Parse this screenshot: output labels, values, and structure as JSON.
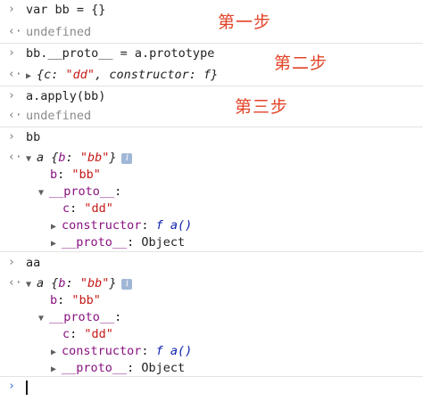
{
  "entries": [
    {
      "input": "var bb = {}",
      "output": "undefined",
      "annotation": "第一步"
    },
    {
      "input": "bb.__proto__ = a.prototype",
      "annotation": "第二步"
    },
    {
      "input": "a.apply(bb)",
      "output": "undefined",
      "annotation": "第三步"
    },
    {
      "input": "bb"
    },
    {
      "input": "aa"
    }
  ],
  "entry2_output": {
    "open": "{",
    "c_key": "c",
    "c_val": "\"dd\"",
    "comma": ", ",
    "ctor_key": "constructor",
    "ctor_val": "f",
    "close": "}"
  },
  "obj": {
    "head_name": "a",
    "head_open": "{",
    "head_key": "b",
    "head_val": "\"bb\"",
    "head_close": "}",
    "info": "i",
    "b_key": "b",
    "b_val": "\"bb\"",
    "proto_key": "__proto__",
    "c_key": "c",
    "c_val": "\"dd\"",
    "ctor_key": "constructor",
    "ctor_val": "f a()",
    "proto2_key": "__proto__",
    "proto2_val": "Object"
  },
  "symbols": {
    "prompt": "›",
    "result": "‹·",
    "expand": "▶",
    "collapse": "▼",
    "colon": ":"
  },
  "colors": {
    "annotation": "#e24428",
    "string": "#c41a16",
    "key": "#881280",
    "prompt_active": "#2d6ae3"
  }
}
